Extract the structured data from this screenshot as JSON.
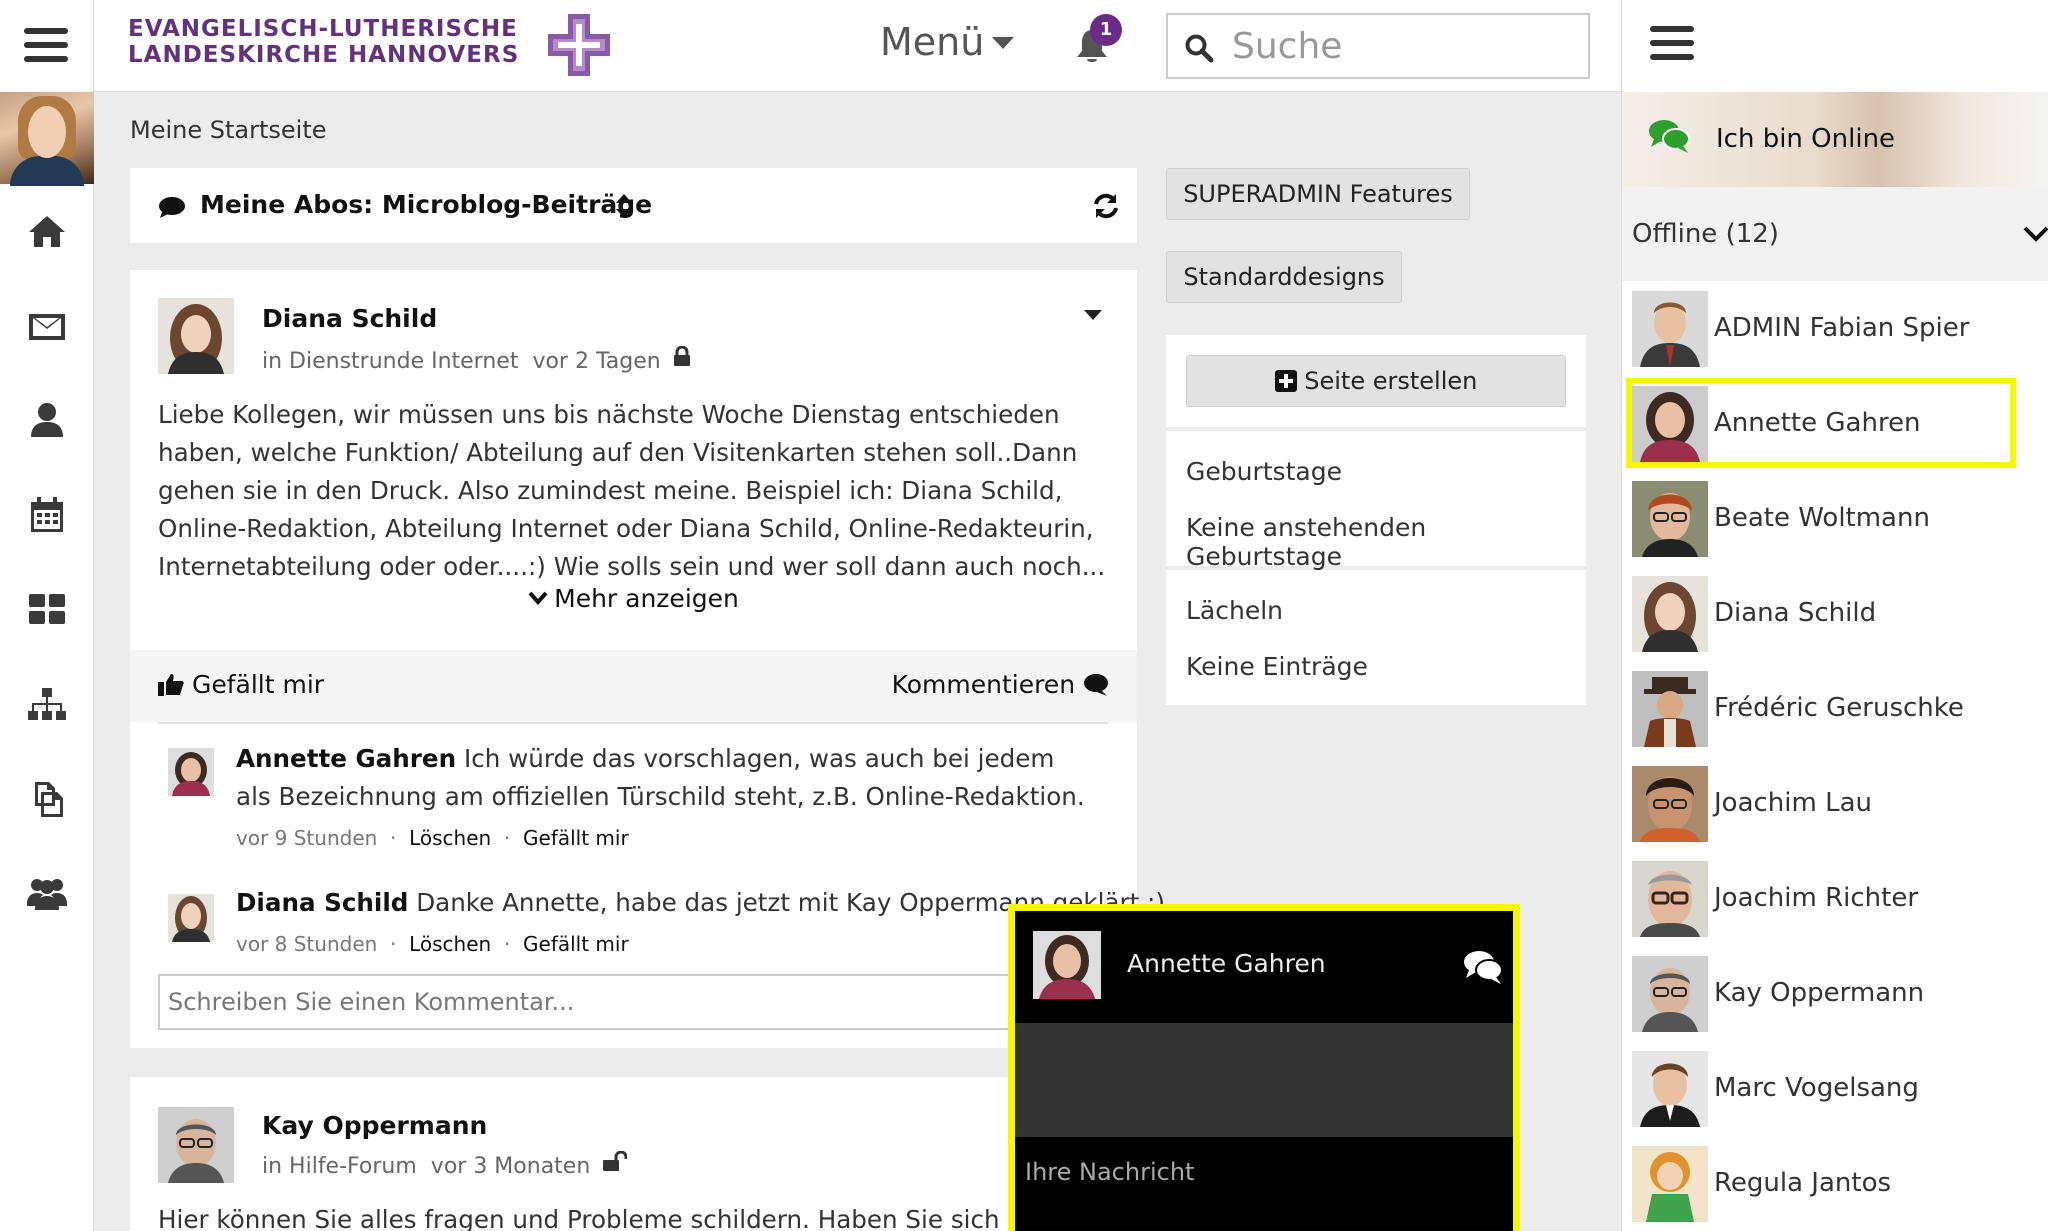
{
  "header": {
    "logo_line1": "EVANGELISCH-LUTHERISCHE",
    "logo_line2": "LANDESKIRCHE HANNOVERS",
    "menu_label": "Menü",
    "notification_count": "1",
    "search_placeholder": "Suche"
  },
  "left_rail": {
    "icons": [
      "home-icon",
      "envelope-icon",
      "user-icon",
      "calendar-icon",
      "dashboard-icon",
      "sitemap-icon",
      "documents-icon",
      "group-icon"
    ]
  },
  "breadcrumb": "Meine Startseite",
  "feed": {
    "title": "Meine Abos: Microblog-Beiträge",
    "posts": [
      {
        "author": "Diana Schild",
        "group": "in Dienstrunde Internet",
        "time": "vor 2 Tagen",
        "body": "Liebe Kollegen, wir müssen uns bis nächste Woche Dienstag entschieden haben, welche Funktion/ Abteilung auf den Visitenkarten stehen soll..Dann gehen sie in den Druck. Also zumindest meine. Beispiel ich: Diana Schild, Online-Redaktion, Abteilung Internet oder Diana Schild, Online-Redakteurin, Internetabteilung oder oder....:) Wie solls sein und wer soll dann auch noch...",
        "more_label": "Mehr anzeigen",
        "like_label": "Gefällt mir",
        "comment_label": "Kommentieren",
        "comments": [
          {
            "author": "Annette Gahren",
            "text": "Ich würde das vorschlagen, was auch bei jedem als Bezeichnung am offiziellen Türschild steht, z.B. Online-Redaktion.",
            "time": "vor 9 Stunden",
            "delete_label": "Löschen",
            "like_label": "Gefällt mir"
          },
          {
            "author": "Diana Schild",
            "text": "Danke Annette, habe das jetzt mit Kay Oppermann geklärt :)",
            "time": "vor 8 Stunden",
            "delete_label": "Löschen",
            "like_label": "Gefällt mir"
          }
        ],
        "comment_placeholder": "Schreiben Sie einen Kommentar..."
      },
      {
        "author": "Kay Oppermann",
        "group": "in Hilfe-Forum",
        "time": "vor 3 Monaten",
        "body": "Hier können Sie alles fragen und Probleme schildern. Haben Sie sich schon"
      }
    ]
  },
  "middle": {
    "superadmin_label": "SUPERADMIN Features",
    "designs_label": "Standarddesigns",
    "create_page_label": "Seite erstellen",
    "birthdays_title": "Geburtstage",
    "birthdays_text": "Keine anstehenden Geburtstage",
    "smile_title": "Lächeln",
    "smile_text": "Keine Einträge"
  },
  "sidebar": {
    "online_label": "Ich bin Online",
    "offline_label": "Offline (12)",
    "contacts": [
      "ADMIN Fabian Spier",
      "Annette Gahren",
      "Beate Woltmann",
      "Diana Schild",
      "Frédéric Geruschke",
      "Joachim Lau",
      "Joachim Richter",
      "Kay Oppermann",
      "Marc Vogelsang",
      "Regula Jantos"
    ]
  },
  "chat": {
    "name": "Annette Gahren",
    "input_placeholder": "Ihre Nachricht"
  },
  "colors": {
    "brand_purple": "#64327d",
    "badge_purple": "#6b2a86",
    "highlight_yellow": "#f7f700",
    "online_green": "#2e9e2e"
  }
}
